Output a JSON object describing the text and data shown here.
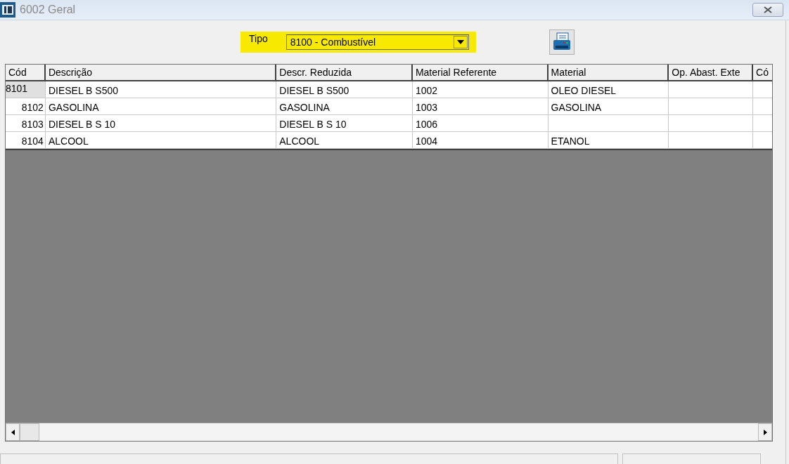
{
  "window": {
    "title": "6002 Geral"
  },
  "filter": {
    "label": "Tipo",
    "value": "8100 - Combustível",
    "highlighted": true
  },
  "table": {
    "columns": [
      "Cód",
      "Descrição",
      "Descr. Reduzida",
      "Material Referente",
      "Material",
      "Op. Abast. Exte",
      "Có"
    ],
    "rows": [
      {
        "selected": true,
        "cells": [
          "8101",
          "DIESEL B S500",
          "DIESEL B S500",
          "1002",
          "OLEO DIESEL",
          "",
          ""
        ]
      },
      {
        "selected": false,
        "cells": [
          "8102",
          "GASOLINA",
          "GASOLINA",
          "1003",
          "GASOLINA",
          "",
          ""
        ]
      },
      {
        "selected": false,
        "cells": [
          "8103",
          "DIESEL B S 10",
          "DIESEL B S 10",
          "1006",
          "",
          "",
          ""
        ]
      },
      {
        "selected": false,
        "cells": [
          "8104",
          "ALCOOL",
          "ALCOOL",
          "1004",
          "ETANOL",
          "",
          ""
        ]
      }
    ]
  }
}
